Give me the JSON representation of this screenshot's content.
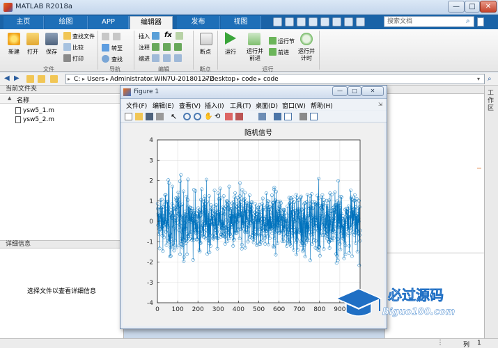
{
  "window": {
    "title": "MATLAB R2018a",
    "controls": [
      "—",
      "□",
      "✕"
    ]
  },
  "tabs": [
    {
      "label": "主页",
      "active": false
    },
    {
      "label": "绘图",
      "active": false
    },
    {
      "label": "APP",
      "active": false
    },
    {
      "label": "编辑器",
      "active": true
    },
    {
      "label": "发布",
      "active": false
    },
    {
      "label": "视图",
      "active": false
    }
  ],
  "search": {
    "placeholder": "搜索文档"
  },
  "ribbon": {
    "file": {
      "label": "文件",
      "new": "新建",
      "open": "打开",
      "save": "保存",
      "find_files": "查找文件",
      "compare": "比较",
      "print": "打印"
    },
    "navigate": {
      "label": "导航",
      "goto": "转至",
      "find": "查找"
    },
    "edit": {
      "label": "编辑",
      "insert": "插入",
      "comment": "注释",
      "indent": "缩进",
      "fx": "fx"
    },
    "breakpoints": {
      "label": "断点",
      "breakpoints": "断点"
    },
    "run": {
      "label": "运行",
      "run": "运行",
      "run_advance": "运行并\n前进",
      "run_section": "运行节",
      "advance": "前进",
      "run_time": "运行并\n计时"
    }
  },
  "address": {
    "crumbs": [
      "C:",
      "Users",
      "Administrator.WIN7U-20180127Z",
      "Desktop",
      "code",
      "code"
    ]
  },
  "current_folder": {
    "title": "当前文件夹",
    "column": "名称",
    "sort_indicator": "▲",
    "files": [
      "ysw5_1.m",
      "ysw5_2.m"
    ]
  },
  "details": {
    "title": "详细信息",
    "message": "选择文件以查看详细信息"
  },
  "right_strip": {
    "label": "工作区"
  },
  "status": {
    "col_label": "列",
    "col_value": "1"
  },
  "figure": {
    "title": "Figure 1",
    "menus": [
      "文件(F)",
      "编辑(E)",
      "查看(V)",
      "插入(I)",
      "工具(T)",
      "桌面(D)",
      "窗口(W)",
      "帮助(H)"
    ]
  },
  "chart_data": {
    "type": "line",
    "title": "随机信号",
    "xlabel": "",
    "ylabel": "",
    "xlim": [
      0,
      1000
    ],
    "ylim": [
      -4,
      4
    ],
    "xticks": [
      0,
      100,
      200,
      300,
      400,
      500,
      600,
      700,
      800,
      900,
      1000
    ],
    "yticks": [
      -4,
      -3,
      -2,
      -1,
      0,
      1,
      2,
      3,
      4
    ],
    "grid": true,
    "marker": "circle",
    "color": "#0072bd",
    "series": [
      {
        "n_points": 1000,
        "envelope_x": [
          0,
          40,
          80,
          100,
          120,
          160,
          200,
          250,
          300,
          350,
          400,
          450,
          500,
          550,
          600,
          650,
          700,
          750,
          800,
          850,
          900,
          950,
          1000
        ],
        "envelope_y": [
          2.4,
          2.8,
          3.6,
          3.9,
          3.2,
          2.6,
          2.9,
          2.7,
          2.6,
          2.4,
          2.9,
          2.6,
          2.2,
          2.5,
          2.3,
          2.0,
          2.9,
          3.0,
          3.0,
          2.8,
          3.2,
          2.6,
          2.5
        ]
      }
    ]
  },
  "watermark": {
    "cn": "必过源码",
    "en": "Biguo100.com"
  }
}
